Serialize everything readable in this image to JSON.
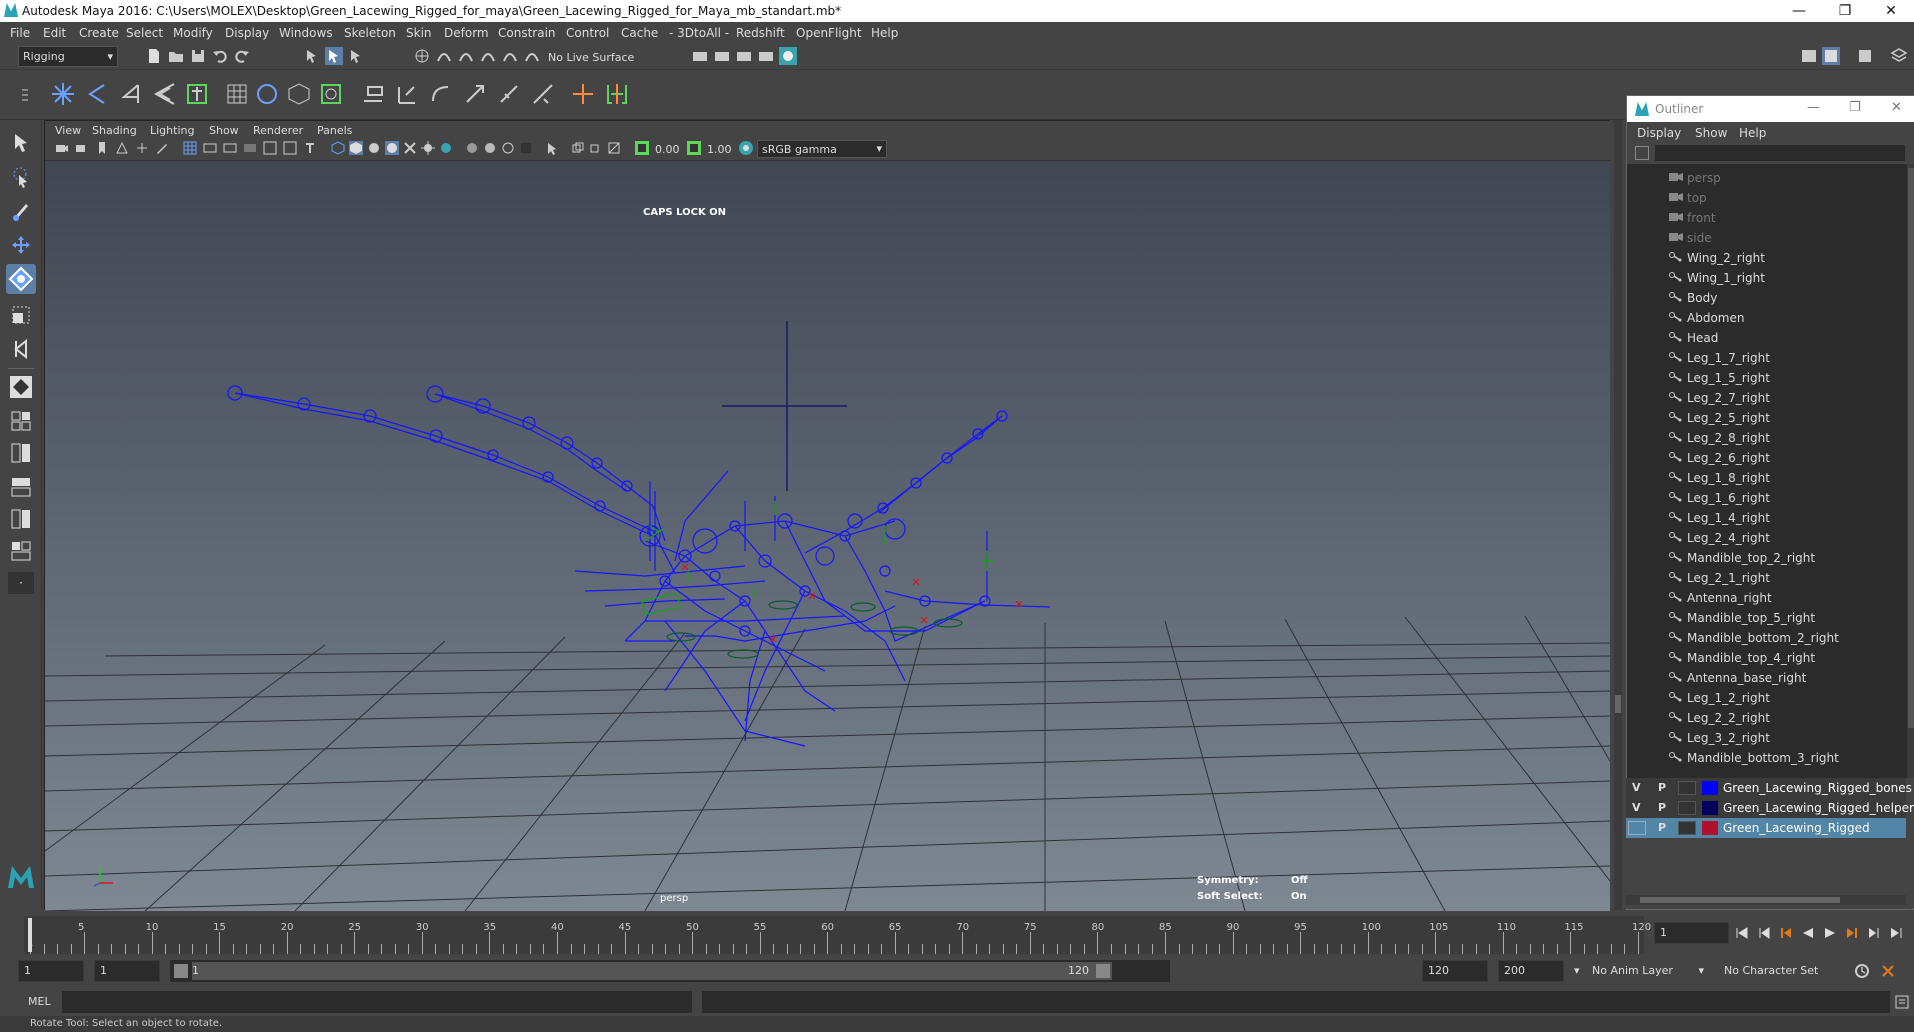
{
  "window": {
    "title": "Autodesk Maya 2016: C:\\Users\\MOLEX\\Desktop\\Green_Lacewing_Rigged_for_maya\\Green_Lacewing_Rigged_for_Maya_mb_standart.mb*",
    "minimize": "—",
    "maximize": "❐",
    "close": "✕"
  },
  "menubar": [
    "File",
    "Edit",
    "Create",
    "Select",
    "Modify",
    "Display",
    "Windows",
    "Skeleton",
    "Skin",
    "Deform",
    "Constrain",
    "Control",
    "Cache",
    "- 3DtoAll -",
    "Redshift",
    "OpenFlight",
    "Help"
  ],
  "shelf": {
    "mode": "Rigging",
    "live_surface": "No Live Surface"
  },
  "viewport": {
    "menu": [
      "View",
      "Shading",
      "Lighting",
      "Show",
      "Renderer",
      "Panels"
    ],
    "near_value": "0.00",
    "far_value": "1.00",
    "color_space": "sRGB gamma",
    "caps_lock": "CAPS LOCK ON",
    "camera": "persp",
    "symmetry_label": "Symmetry:",
    "symmetry_value": "Off",
    "soft_select_label": "Soft Select:",
    "soft_select_value": "On"
  },
  "outliner": {
    "title": "Outliner",
    "menu": [
      "Display",
      "Show",
      "Help"
    ],
    "items": [
      {
        "name": "persp",
        "type": "camera"
      },
      {
        "name": "top",
        "type": "camera"
      },
      {
        "name": "front",
        "type": "camera"
      },
      {
        "name": "side",
        "type": "camera"
      },
      {
        "name": "Wing_2_right",
        "type": "joint"
      },
      {
        "name": "Wing_1_right",
        "type": "joint"
      },
      {
        "name": "Body",
        "type": "joint"
      },
      {
        "name": "Abdomen",
        "type": "joint"
      },
      {
        "name": "Head",
        "type": "joint"
      },
      {
        "name": "Leg_1_7_right",
        "type": "joint"
      },
      {
        "name": "Leg_1_5_right",
        "type": "joint"
      },
      {
        "name": "Leg_2_7_right",
        "type": "joint"
      },
      {
        "name": "Leg_2_5_right",
        "type": "joint"
      },
      {
        "name": "Leg_2_8_right",
        "type": "joint"
      },
      {
        "name": "Leg_2_6_right",
        "type": "joint"
      },
      {
        "name": "Leg_1_8_right",
        "type": "joint"
      },
      {
        "name": "Leg_1_6_right",
        "type": "joint"
      },
      {
        "name": "Leg_1_4_right",
        "type": "joint"
      },
      {
        "name": "Leg_2_4_right",
        "type": "joint"
      },
      {
        "name": "Mandible_top_2_right",
        "type": "joint"
      },
      {
        "name": "Leg_2_1_right",
        "type": "joint"
      },
      {
        "name": "Antenna_right",
        "type": "joint"
      },
      {
        "name": "Mandible_top_5_right",
        "type": "joint"
      },
      {
        "name": "Mandible_bottom_2_right",
        "type": "joint"
      },
      {
        "name": "Mandible_top_4_right",
        "type": "joint"
      },
      {
        "name": "Antenna_base_right",
        "type": "joint"
      },
      {
        "name": "Leg_1_2_right",
        "type": "joint"
      },
      {
        "name": "Leg_2_2_right",
        "type": "joint"
      },
      {
        "name": "Leg_3_2_right",
        "type": "joint"
      },
      {
        "name": "Mandible_bottom_3_right",
        "type": "joint"
      }
    ]
  },
  "layers": [
    {
      "v": "V",
      "p": "P",
      "color": "#0000ff",
      "name": "Green_Lacewing_Rigged_bones",
      "selected": false
    },
    {
      "v": "V",
      "p": "P",
      "color": "#00005a",
      "name": "Green_Lacewing_Rigged_helpers",
      "selected": false
    },
    {
      "v": "",
      "p": "P",
      "color": "#b0102a",
      "name": "Green_Lacewing_Rigged",
      "selected": true
    }
  ],
  "timeline": {
    "ticks": [
      "5",
      "10",
      "15",
      "20",
      "25",
      "30",
      "35",
      "40",
      "45",
      "50",
      "55",
      "60",
      "65",
      "70",
      "75",
      "80",
      "85",
      "90",
      "95",
      "100",
      "105",
      "110",
      "115",
      "120"
    ],
    "current_marker": "1",
    "current_frame": "1"
  },
  "range": {
    "start": "1",
    "playback_start": "1",
    "slider_start": "1",
    "slider_end": "120",
    "playback_end": "120",
    "end": "200",
    "anim_layer": "No Anim Layer",
    "character_set": "No Character Set"
  },
  "cmdline": {
    "label": "MEL"
  },
  "helpline": "Rotate Tool: Select an object to rotate."
}
